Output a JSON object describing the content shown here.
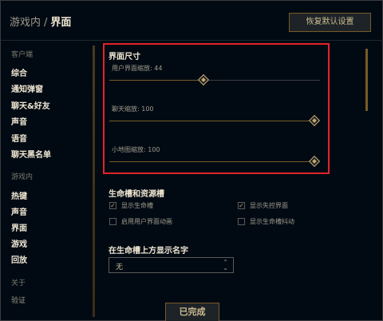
{
  "header": {
    "breadcrumb_parent": "游戏内",
    "breadcrumb_separator": "/",
    "breadcrumb_current": "界面",
    "restore_button": "恢复默认设置"
  },
  "sidebar": {
    "section_client": "客户端",
    "client_items": [
      "综合",
      "通知弹窗",
      "聊天&好友",
      "声音",
      "语音",
      "聊天黑名单"
    ],
    "section_ingame": "游戏内",
    "ingame_items": [
      "热键",
      "声音",
      "界面",
      "游戏",
      "回放"
    ],
    "section_about": "关于",
    "about_items": [
      "验证"
    ]
  },
  "ui_size": {
    "title": "界面尺寸",
    "sliders": [
      {
        "label": "用户界面缩放: 44",
        "value": 44
      },
      {
        "label": "聊天缩放: 100",
        "value": 100
      },
      {
        "label": "小地图缩放: 100",
        "value": 100
      }
    ]
  },
  "health_bars": {
    "title": "生命槽和资源槽",
    "checkboxes": [
      {
        "label": "显示生命槽",
        "checked": true
      },
      {
        "label": "显示失控界面",
        "checked": true
      },
      {
        "label": "启用用户界面动画",
        "checked": false
      },
      {
        "label": "显示生命槽抖动",
        "checked": false
      }
    ]
  },
  "names": {
    "title": "在生命槽上方显示名字",
    "dropdown_value": "无"
  },
  "footer": {
    "done_button": "已完成"
  },
  "colors": {
    "accent_gold": "#c8aa6e",
    "highlight_red": "#e0242a",
    "background": "#010a13"
  }
}
